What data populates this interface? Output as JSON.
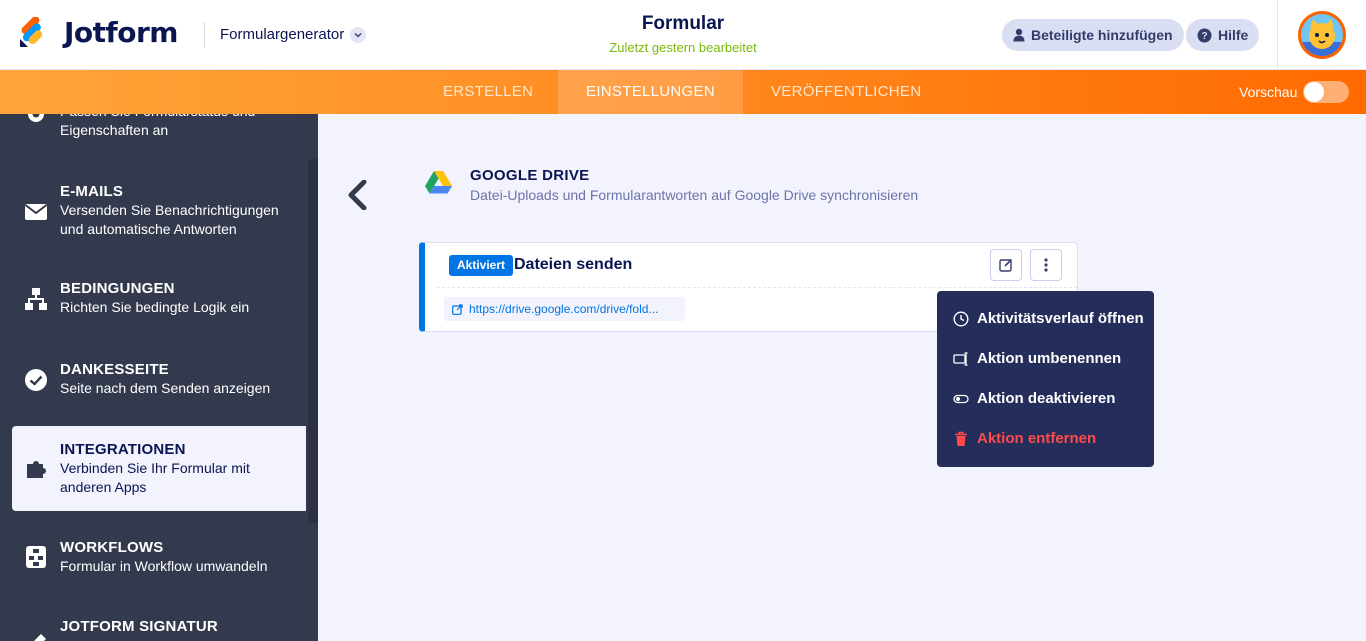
{
  "header": {
    "brand": "Jotform",
    "form_generator": "Formulargenerator",
    "form_title": "Formular",
    "last_edited": "Zuletzt gestern bearbeitet",
    "add_collaborators": "Beteiligte hinzufügen",
    "help": "Hilfe"
  },
  "tabs": {
    "build": "ERSTELLEN",
    "settings": "EINSTELLUNGEN",
    "publish": "VERÖFFENTLICHEN",
    "preview": "Vorschau"
  },
  "sidebar": {
    "items": [
      {
        "title": "",
        "desc": "Passen Sie Formularstatus und Eigenschaften an"
      },
      {
        "title": "E-MAILS",
        "desc": "Versenden Sie Benachrichtigungen und automatische Antworten"
      },
      {
        "title": "BEDINGUNGEN",
        "desc": "Richten Sie bedingte Logik ein"
      },
      {
        "title": "DANKESSEITE",
        "desc": "Seite nach dem Senden anzeigen"
      },
      {
        "title": "INTEGRATIONEN",
        "desc": "Verbinden Sie Ihr Formular mit anderen Apps"
      },
      {
        "title": "WORKFLOWS",
        "desc": "Formular in Workflow umwandeln"
      },
      {
        "title": "JOTFORM SIGNATUR",
        "desc": ""
      }
    ]
  },
  "integration": {
    "title": "GOOGLE DRIVE",
    "desc": "Datei-Uploads und Formularantworten auf Google Drive synchronisieren",
    "card": {
      "badge": "Aktiviert",
      "title": "Dateien senden",
      "link": "https://drive.google.com/drive/fold..."
    }
  },
  "menu": {
    "history": "Aktivitätsverlauf öffnen",
    "rename": "Aktion umbenennen",
    "disable": "Aktion deaktivieren",
    "remove": "Aktion entfernen"
  },
  "colors": {
    "accent_blue": "#0075e3",
    "orange": "#ff6100",
    "danger": "#ff4a4a",
    "sidebar_bg": "#343a4e",
    "menu_bg": "#252d5b"
  }
}
